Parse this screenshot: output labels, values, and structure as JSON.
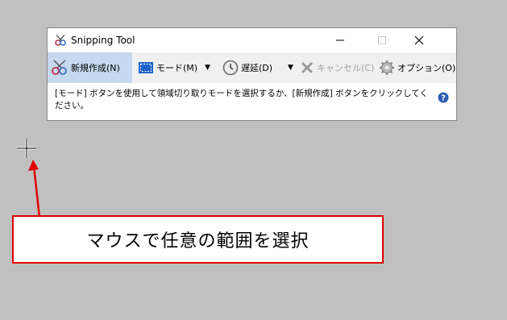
{
  "window": {
    "title": "Snipping Tool"
  },
  "toolbar": {
    "new_label": "新規作成(N)",
    "mode_label": "モード(M)",
    "delay_label": "遅延(D)",
    "cancel_label": "キャンセル(C)",
    "options_label": "オプション(O)"
  },
  "hint": {
    "text": "[モード] ボタンを使用して領域切り取りモードを選択するか、[新規作成] ボタンをクリックしてください。"
  },
  "callout": {
    "text": "マウスで任意の範囲を選択"
  },
  "colors": {
    "background": "#c0c0c0",
    "toolbar": "#f0f0f0",
    "selected_button": "#c7d9ef",
    "annotation_red": "#e00000"
  }
}
